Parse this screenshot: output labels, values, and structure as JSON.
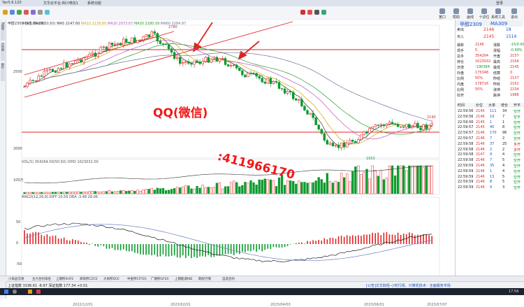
{
  "titlebar": {
    "app": "Yan5.6.120",
    "menu": [
      "文华云平台-四川电信1",
      "系统功能"
    ],
    "right": "登录"
  },
  "toolbar": {
    "buttons": [
      "宽口",
      "帮助",
      "画线",
      "十进位",
      "系统工具",
      "退出"
    ]
  },
  "leftbar": [
    "K线图",
    "分时图",
    "报价"
  ],
  "chart": {
    "legend_top": "MA(5,10,20,30,60)",
    "legend_ma": [
      "MA5 2147.60",
      "MA10 2139.60",
      "MA20 2073.67",
      "MA30 2180.09",
      "MA60 2284.97"
    ],
    "left_label": "甲醇2309 日线 MA690",
    "vol_legend": "VOL(5)  354264.00(50:50)  OPID 1623032.00",
    "macd_legend": "MACD(12,26,9)  DIFF 10.55  DEA -3.48  28.06",
    "price_ticks": [
      "2500",
      "2000",
      "2700",
      "1953",
      "2190"
    ],
    "high_label": "2780",
    "low_label": "1953",
    "right_label": "2190",
    "vol_tick": "100万",
    "macd_ticks": [
      "50",
      "0",
      "-50"
    ],
    "date_ticks": [
      "2022/12/01",
      "2023/02/01",
      "2023/04/03",
      "2023/06/01",
      "2023/07/07"
    ]
  },
  "watermark": {
    "line1": "QQ(微信)",
    "line2": ":411966170"
  },
  "quote": {
    "title": "甲醇2309",
    "code": "MA309",
    "sell_label": "卖出",
    "sell_price": "2146",
    "sell_vol": "18",
    "buy_label": "买入",
    "buy_price": "2145",
    "buy_vol": "1514",
    "rows": [
      {
        "a": "最新",
        "b": "2146",
        "c": "涨跌",
        "d": "-15/0.69%"
      },
      {
        "a": "现手",
        "b": "5",
        "c": "涨幅",
        "d": "-0.69%"
      },
      {
        "a": "总手",
        "b": "354264",
        "c": "开盘",
        "d": "2157"
      },
      {
        "a": "持仓",
        "b": "1623032",
        "c": "最高",
        "d": "2164"
      },
      {
        "a": "日增",
        "b": "-190384",
        "c": "最低",
        "d": "2145"
      },
      {
        "a": "外盘",
        "b": "175348",
        "c": "结算",
        "d": "0"
      },
      {
        "a": "比例",
        "b": "50%",
        "c": "昨结",
        "d": "2157"
      },
      {
        "a": "内盘",
        "b": "178716",
        "c": "昨收",
        "d": "2161"
      },
      {
        "a": "比例",
        "b": "50%",
        "c": "涨停",
        "d": "2234"
      },
      {
        "a": "杠杆",
        "b": "",
        "c": "跌停",
        "d": "1988"
      }
    ],
    "ticks_header": [
      "时间",
      "价位",
      "大单",
      "增仓",
      "开平"
    ],
    "ticks": [
      [
        "22:59:56",
        "2145",
        "111",
        "34",
        "空开"
      ],
      [
        "22:59:56",
        "2146",
        "19",
        "7",
        "空平"
      ],
      [
        "22:59:56",
        "2145",
        "1",
        "1",
        "空开"
      ],
      [
        "22:59:57",
        "2145",
        "40",
        "8",
        "空开"
      ],
      [
        "22:59:57",
        "2146",
        "170",
        "96",
        "空开"
      ],
      [
        "22:59:57",
        "2146",
        "7",
        "2",
        "空开"
      ],
      [
        "22:59:58",
        "2146",
        "37",
        "25",
        "多开"
      ],
      [
        "22:59:58",
        "2146",
        "2",
        "2",
        "多开"
      ],
      [
        "22:59:58",
        "2147",
        "9",
        "4",
        "空开"
      ],
      [
        "22:59:58",
        "2146",
        "7",
        "5",
        "空开"
      ],
      [
        "22:59:59",
        "2146",
        "35",
        "4",
        "空开"
      ],
      [
        "22:59:59",
        "2146",
        "1",
        "4",
        "空开"
      ],
      [
        "22:59:59",
        "2146",
        "13",
        "5",
        "空开"
      ],
      [
        "22:59:59",
        "2146",
        "8",
        "5",
        "空开"
      ],
      [
        "22:59:59",
        "2146",
        "9",
        "3",
        "空开"
      ]
    ]
  },
  "tabstrip": [
    "小商品交易",
    "主力合约排名",
    "上期所SHFE",
    "郑商所CZCE",
    "大商所DCE",
    "中金所CFFEX",
    "广期所GFEX",
    "上期能源INE",
    "期权行情",
    "自选合约"
  ],
  "statusbar": {
    "left": "上证指数  3196.61  -8.97   深证指数  177.34  +0.01",
    "right": "[公告]文华财经-小时行情、计算机技术：全面服务市场",
    "time": "17:56"
  },
  "colors": {
    "up": "#e02424",
    "down": "#0a9a2c",
    "arrow": "#e02424"
  }
}
